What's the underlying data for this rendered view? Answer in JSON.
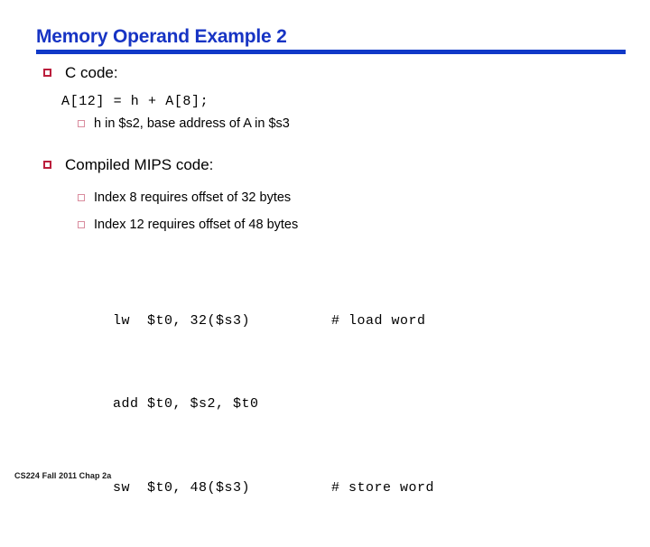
{
  "slide": {
    "title": "Memory Operand Example 2",
    "accent_color": "#1039c8",
    "title_color": "#1734c4",
    "bullet_color": "#bb1e3c",
    "subbullet_color": "#d98c9e",
    "background": "#ffffff"
  },
  "sections": {
    "c_code": {
      "heading": "C code:",
      "code_line": "A[12] = h + A[8];",
      "note": "h in $s2, base address of A in $s3"
    },
    "mips": {
      "heading": "Compiled MIPS code:",
      "notes": [
        "Index 8 requires offset of 32 bytes",
        "Index 12 requires offset of 48 bytes"
      ],
      "code_lines": [
        {
          "instruction": "lw  $t0, 32($s3)",
          "comment": "# load word"
        },
        {
          "instruction": "add $t0, $s2, $t0",
          "comment": ""
        },
        {
          "instruction": "sw  $t0, 48($s3)",
          "comment": "# store word"
        }
      ]
    }
  },
  "footer": {
    "text": "CS224 Fall 2011 Chap 2a"
  }
}
